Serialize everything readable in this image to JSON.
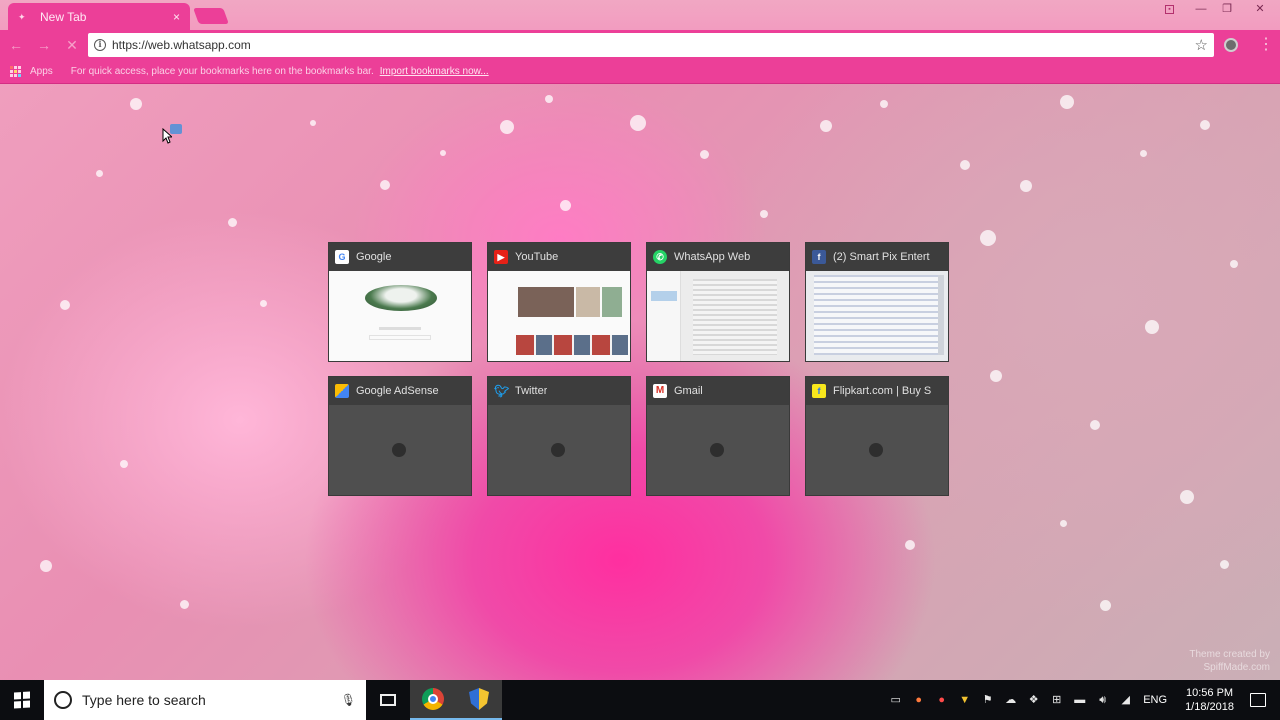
{
  "browser": {
    "tab": {
      "title": "New Tab",
      "close": "×"
    },
    "omnibox": {
      "url": "https://web.whatsapp.com"
    },
    "bookmarks": {
      "apps_label": "Apps",
      "hint": "For quick access, place your bookmarks here on the bookmarks bar.",
      "import_link": "Import bookmarks now..."
    }
  },
  "tiles": [
    {
      "title": "Google",
      "icon": "google-icon",
      "color": "#ffffff"
    },
    {
      "title": "YouTube",
      "icon": "youtube-icon",
      "color": "#e62117"
    },
    {
      "title": "WhatsApp Web",
      "icon": "whatsapp-icon",
      "color": "#25d366"
    },
    {
      "title": "(2) Smart Pix Entert",
      "icon": "facebook-icon",
      "color": "#3b5998"
    },
    {
      "title": "Google AdSense",
      "icon": "adsense-icon",
      "color": "#fbbc05"
    },
    {
      "title": "Twitter",
      "icon": "twitter-icon",
      "color": "#1da1f2"
    },
    {
      "title": "Gmail",
      "icon": "gmail-icon",
      "color": "#ffffff"
    },
    {
      "title": "Flipkart.com | Buy S",
      "icon": "flipkart-icon",
      "color": "#f8e71c"
    }
  ],
  "watermark": {
    "line1": "Theme created by",
    "line2": "SpiffMade.com"
  },
  "taskbar": {
    "search_placeholder": "Type here to search",
    "language": "ENG",
    "time": "10:56 PM",
    "date": "1/18/2018"
  }
}
